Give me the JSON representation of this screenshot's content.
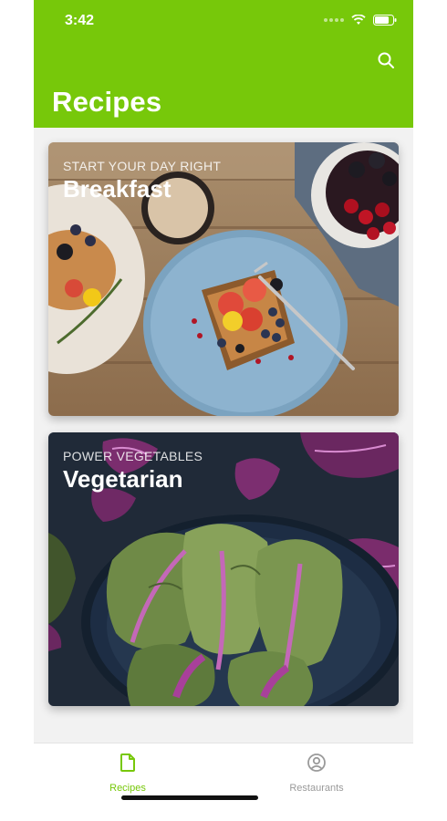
{
  "status_bar": {
    "time": "3:42"
  },
  "header": {
    "title": "Recipes",
    "search_icon": "search-icon"
  },
  "cards": [
    {
      "subtitle": "START YOUR DAY RIGHT",
      "title": "Breakfast"
    },
    {
      "subtitle": "POWER VEGETABLES",
      "title": "Vegetarian"
    }
  ],
  "tabs": [
    {
      "label": "Recipes",
      "icon": "document-icon",
      "active": true
    },
    {
      "label": "Restaurants",
      "icon": "person-circle-icon",
      "active": false
    }
  ],
  "colors": {
    "accent": "#77c80a",
    "inactive_tab": "#9a9a9a",
    "background": "#f2f2f2"
  }
}
